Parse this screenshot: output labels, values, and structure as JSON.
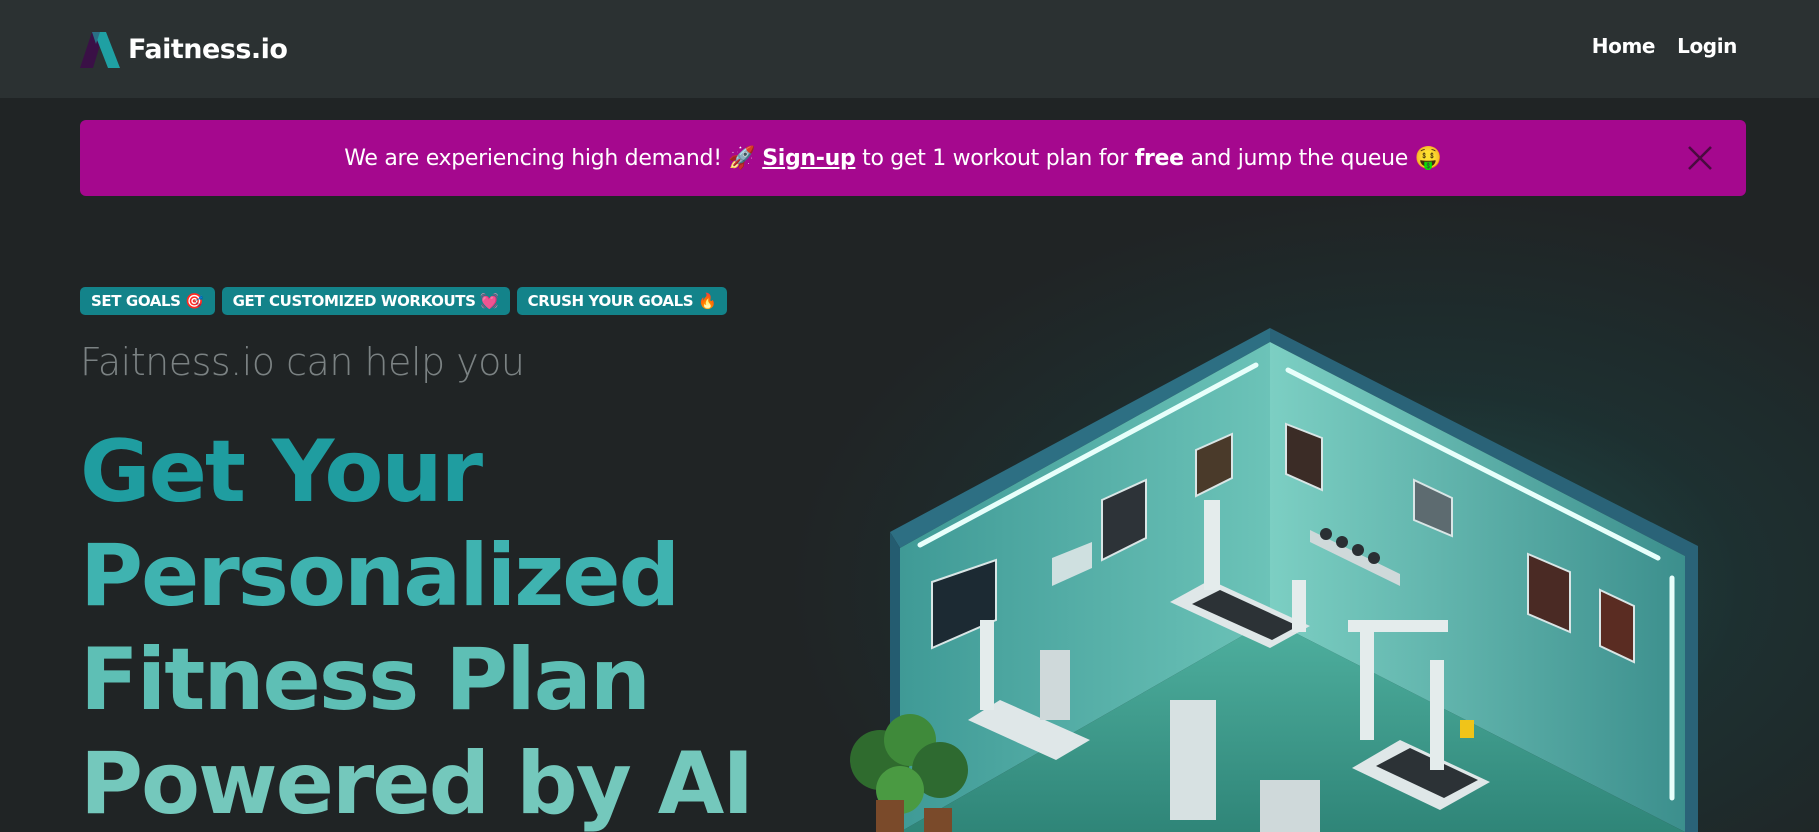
{
  "header": {
    "brand": "Faitness.io",
    "nav": [
      {
        "label": "Home"
      },
      {
        "label": "Login"
      }
    ]
  },
  "banner": {
    "text_before": "We are experiencing high demand! 🚀 ",
    "link_label": "Sign-up",
    "text_middle": " to get 1 workout plan for ",
    "bold_word": "free",
    "text_after": " and jump the queue 🤑"
  },
  "hero": {
    "badges": [
      {
        "label": "SET GOALS 🎯"
      },
      {
        "label": "GET CUSTOMIZED WORKOUTS 💓"
      },
      {
        "label": "CRUSH YOUR GOALS 🔥"
      }
    ],
    "subtitle": "Faitness.io can help you",
    "headline_lines": [
      "Get Your",
      "Personalized",
      "Fitness Plan",
      "Powered by AI"
    ]
  },
  "colors": {
    "page_bg": "#202425",
    "header_bg": "#2b3132",
    "banner_bg": "#a5088e",
    "badge_bg": "#13838a",
    "accent_teal": "#1f9da0"
  },
  "icons": {
    "logo": "faitness-logo-icon",
    "close": "close-icon"
  }
}
